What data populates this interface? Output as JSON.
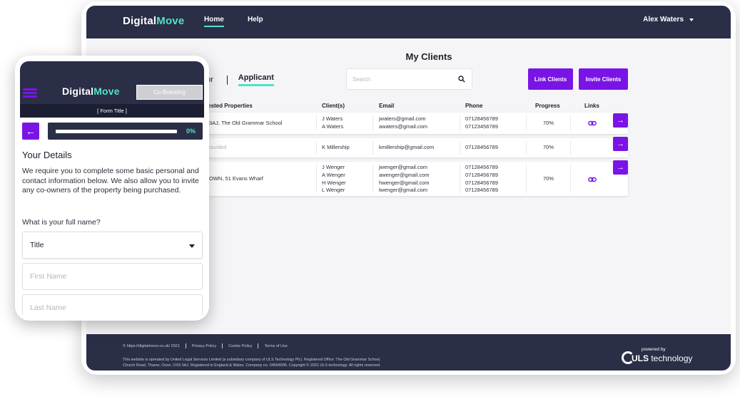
{
  "desktop": {
    "logo": {
      "part1": "Digital",
      "part2": "Move"
    },
    "nav": {
      "home": "Home",
      "help": "Help"
    },
    "user": "Alex Waters",
    "page_title": "My Clients",
    "tabs": {
      "partial": "or",
      "active": "Applicant"
    },
    "search": {
      "placeholder": "Search"
    },
    "buttons": {
      "link_clients": "Link Clients",
      "invite_clients": "Invite Clients"
    },
    "table": {
      "headers": {
        "properties": "rested Properties",
        "clients": "Client(s)",
        "email": "Email",
        "phone": "Phone",
        "progress": "Progress",
        "links": "Links"
      },
      "rows": [
        {
          "property": "3AJ, The Old Grammar School",
          "clients": [
            "J Waters",
            "A Waters"
          ],
          "emails": [
            "jwaters@gmail.com",
            "awaters@gmail.com"
          ],
          "phones": [
            "07128456789",
            "07123456789"
          ],
          "progress": "70%",
          "has_link": true
        },
        {
          "property": "rovided",
          "clients": [
            "K Millership"
          ],
          "emails": [
            "kmillership@gmail.com"
          ],
          "phones": [
            "07128456789"
          ],
          "progress": "70%",
          "has_link": false
        },
        {
          "property": "OWN, 51 Evans Wharf",
          "clients": [
            "J Wenger",
            "A Wenger",
            "H Wenger",
            "L Wenger"
          ],
          "emails": [
            "jwenger@gmail.com",
            "awenger@gmail.com",
            "hwenger@gmail.com",
            "lwenger@gmail.com"
          ],
          "phones": [
            "07128456789",
            "07128456789",
            "07128456789",
            "07128456789"
          ],
          "progress": "70%",
          "has_link": true
        }
      ]
    },
    "footer": {
      "links": [
        "© https://digitalmove.co.uk/ 2021",
        "Privacy Policy",
        "Cookie Policy",
        "Terms of Use"
      ],
      "legal_1": "This website is operated by United Legal Services Limited (a subsidiary company of ULS Technology Plc). Registered Office: The Old Grammar School,",
      "legal_2": "Church Road, Thame, Oxon, OX9 3AJ. Registered in England & Wales. Company no. 04594095. Copyright © 2021 ULS technology. All rights reserved.",
      "powered_label": "powered by",
      "powered_brand_bold": "ULS",
      "powered_brand_rest": "technology"
    }
  },
  "mobile": {
    "cobranding": "Co-Branding",
    "form_title": "[ Form Title ]",
    "progress": {
      "label": "0%",
      "fraction": 0
    },
    "heading": "Your Details",
    "intro": "We require you to complete some basic personal and contact information below. We also allow you to invite any co-owners of the property being purchased.",
    "question": "What is your full name?",
    "title_select": "Title",
    "first_name_placeholder": "First Name",
    "last_name_placeholder": "Last Name"
  },
  "colors": {
    "navy": "#2a2e47",
    "purple": "#7a14e6",
    "teal": "#4fe3c8"
  }
}
